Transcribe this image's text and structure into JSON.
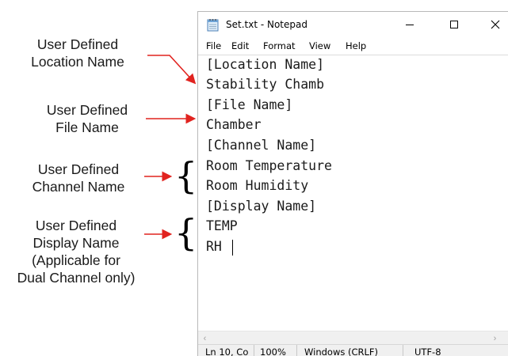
{
  "window": {
    "title": "Set.txt - Notepad",
    "app_icon": "notepad-icon",
    "buttons": {
      "minimize": "minimize-icon",
      "maximize": "maximize-icon",
      "close": "close-icon"
    }
  },
  "menu": {
    "file": "File",
    "edit": "Edit",
    "format": "Format",
    "view": "View",
    "help": "Help"
  },
  "editor": {
    "lines": [
      "[Location Name]",
      "Stability Chamb",
      "[File Name]",
      "Chamber",
      "[Channel Name]",
      "Room Temperature",
      "Room Humidity",
      "[Display Name]",
      "TEMP",
      "RH "
    ]
  },
  "status": {
    "position": "Ln 10, Co",
    "zoom": "100%",
    "line_ending": "Windows (CRLF)",
    "encoding": "UTF-8"
  },
  "annotations": {
    "location": [
      "User Defined",
      "Location Name"
    ],
    "file": [
      "User Defined",
      "File Name"
    ],
    "channel": [
      "User Defined",
      "Channel Name"
    ],
    "display": [
      "User Defined",
      "Display Name",
      "(Applicable for",
      "Dual Channel only)"
    ]
  },
  "colors": {
    "arrow": "#e1231f",
    "text": "#1a1a1a"
  }
}
